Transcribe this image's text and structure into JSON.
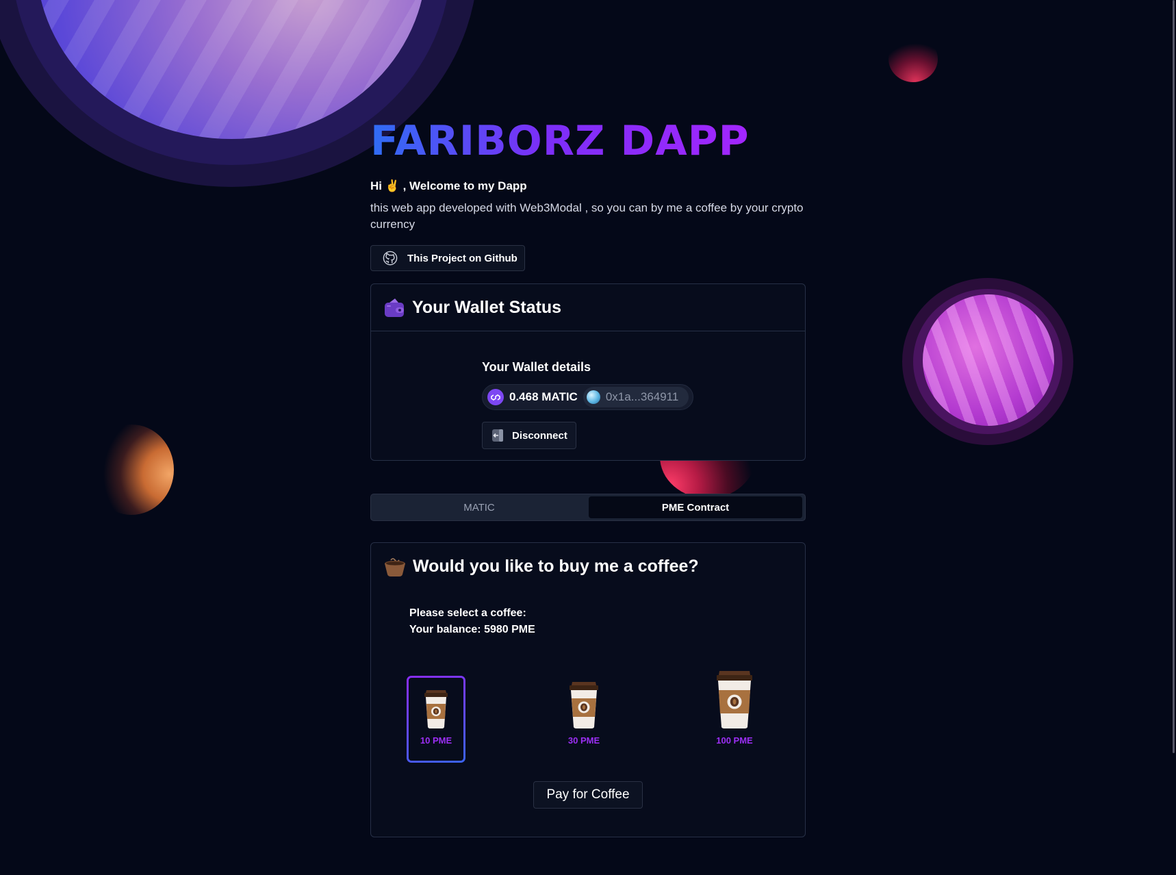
{
  "app": {
    "title": "FARIBORZ DAPP",
    "greeting": "Hi ✌️ , Welcome to my Dapp",
    "description": "this web app developed with Web3Modal , so you can by me a coffee by your crypto currency",
    "github_button": "This Project on Github"
  },
  "wallet": {
    "heading": "Your Wallet Status",
    "details_title": "Your Wallet details",
    "balance": "0.468 MATIC",
    "address": "0x1a...364911",
    "disconnect_label": "Disconnect"
  },
  "tabs": [
    {
      "label": "MATIC",
      "active": false
    },
    {
      "label": "PME Contract",
      "active": true
    }
  ],
  "coffee": {
    "heading": "Would you like to buy me a coffee?",
    "select_prompt": "Please select a coffee:",
    "balance_line": "Your balance: 5980 PME",
    "options": [
      {
        "label": "10 PME",
        "selected": true
      },
      {
        "label": "30 PME",
        "selected": false
      },
      {
        "label": "100 PME",
        "selected": false
      }
    ],
    "pay_label": "Pay for Coffee"
  },
  "colors": {
    "background": "#040818",
    "accent_purple": "#9b2ff5",
    "accent_blue": "#2f6df5",
    "card_border": "#273047"
  }
}
